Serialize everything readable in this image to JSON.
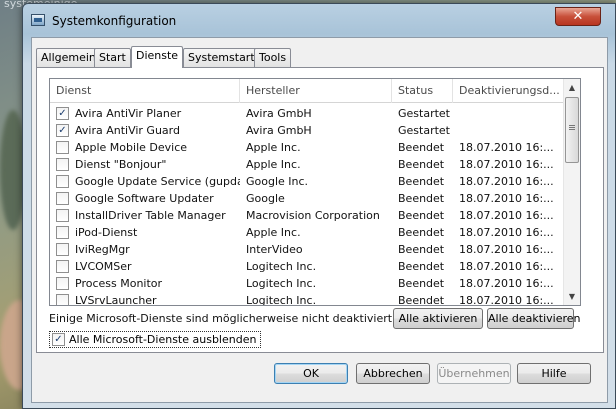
{
  "background": {
    "fragment_text": "systemeinige"
  },
  "window": {
    "title": "Systemkonfiguration",
    "close_glyph": "✕"
  },
  "tabs": [
    "Allgemein",
    "Start",
    "Dienste",
    "Systemstart",
    "Tools"
  ],
  "active_tab": "Dienste",
  "services": {
    "columns": [
      "Dienst",
      "Hersteller",
      "Status",
      "Deaktivierungsd..."
    ],
    "rows": [
      {
        "checked": true,
        "name": "Avira AntiVir Planer",
        "vendor": "Avira GmbH",
        "status": "Gestartet",
        "date": ""
      },
      {
        "checked": true,
        "name": "Avira AntiVir Guard",
        "vendor": "Avira GmbH",
        "status": "Gestartet",
        "date": ""
      },
      {
        "checked": false,
        "name": "Apple Mobile Device",
        "vendor": "Apple Inc.",
        "status": "Beendet",
        "date": "18.07.2010 16:..."
      },
      {
        "checked": false,
        "name": "Dienst \"Bonjour\"",
        "vendor": "Apple Inc.",
        "status": "Beendet",
        "date": "18.07.2010 16:..."
      },
      {
        "checked": false,
        "name": "Google Update Service (gupdate)",
        "vendor": "Google Inc.",
        "status": "Beendet",
        "date": "18.07.2010 16:..."
      },
      {
        "checked": false,
        "name": "Google Software Updater",
        "vendor": "Google",
        "status": "Beendet",
        "date": "18.07.2010 16:..."
      },
      {
        "checked": false,
        "name": "InstallDriver Table Manager",
        "vendor": "Macrovision Corporation",
        "status": "Beendet",
        "date": "18.07.2010 16:..."
      },
      {
        "checked": false,
        "name": "iPod-Dienst",
        "vendor": "Apple Inc.",
        "status": "Beendet",
        "date": "18.07.2010 16:..."
      },
      {
        "checked": false,
        "name": "IviRegMgr",
        "vendor": "InterVideo",
        "status": "Beendet",
        "date": "18.07.2010 16:..."
      },
      {
        "checked": false,
        "name": "LVCOMSer",
        "vendor": "Logitech Inc.",
        "status": "Beendet",
        "date": "18.07.2010 16:..."
      },
      {
        "checked": false,
        "name": "Process Monitor",
        "vendor": "Logitech Inc.",
        "status": "Beendet",
        "date": "18.07.2010 16:..."
      },
      {
        "checked": false,
        "name": "LVSrvLauncher",
        "vendor": "Logitech Inc.",
        "status": "Beendet",
        "date": "18.07.2010 16:..."
      }
    ]
  },
  "note": "Einige Microsoft-Dienste sind möglicherweise nicht deaktiviert.",
  "buttons": {
    "enable_all": "Alle aktivieren",
    "disable_all": "Alle deaktivieren",
    "ok": "OK",
    "cancel": "Abbrechen",
    "apply": "Übernehmen",
    "help": "Hilfe"
  },
  "hide_microsoft": {
    "checked": true,
    "label": "Alle Microsoft-Dienste ausblenden"
  },
  "checkmark_glyph": "✓",
  "scroll_glyphs": {
    "up": "▲",
    "down": "▼"
  }
}
